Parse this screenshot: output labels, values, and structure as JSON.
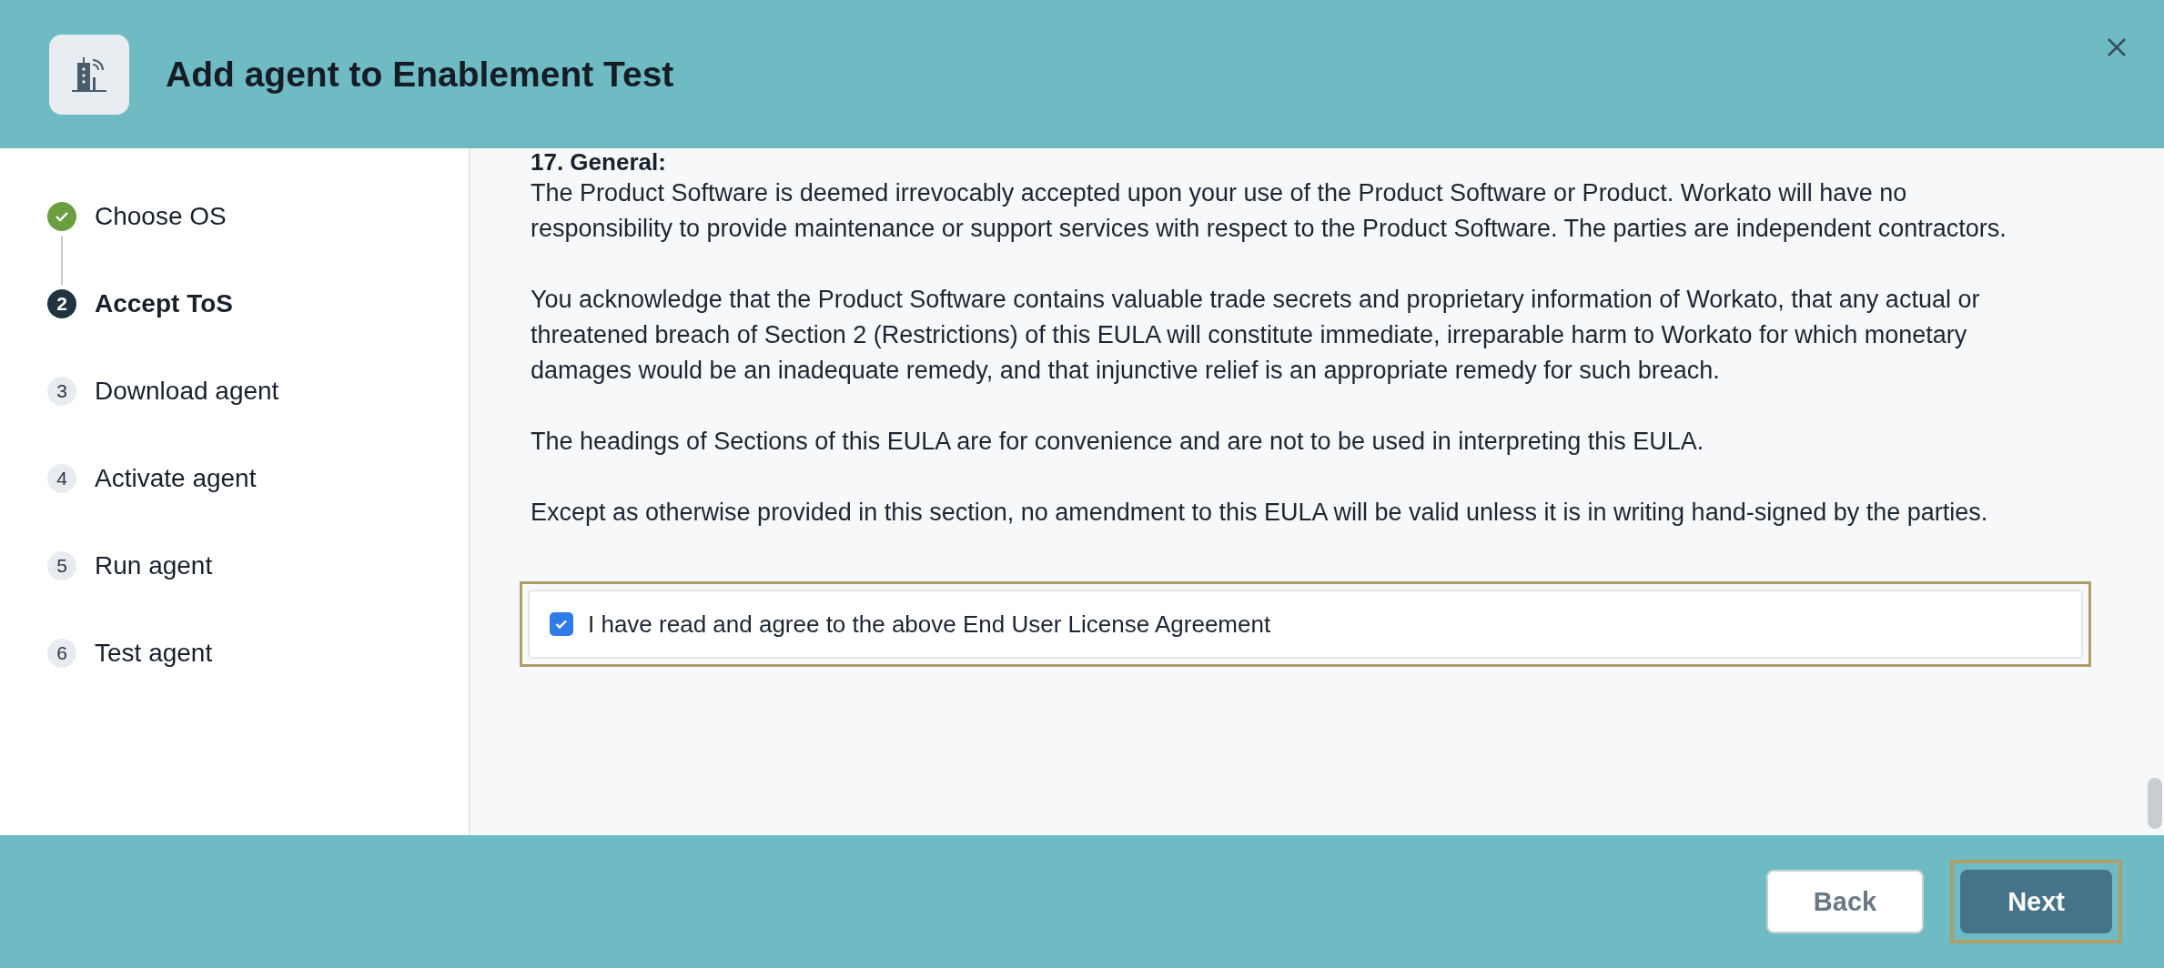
{
  "dialog": {
    "title": "Add agent to Enablement Test"
  },
  "steps": [
    {
      "kind": "done",
      "label": "Choose OS",
      "selected": false
    },
    {
      "kind": "number",
      "number": "2",
      "label": "Accept ToS",
      "selected": true
    },
    {
      "kind": "number",
      "number": "3",
      "label": "Download agent",
      "selected": false
    },
    {
      "kind": "number",
      "number": "4",
      "label": "Activate agent",
      "selected": false
    },
    {
      "kind": "number",
      "number": "5",
      "label": "Run agent",
      "selected": false
    },
    {
      "kind": "number",
      "number": "6",
      "label": "Test agent",
      "selected": false
    }
  ],
  "eula": {
    "heading": "17. General:",
    "paragraphs": [
      "The Product Software is deemed irrevocably accepted upon your use of the Product Software or Product. Workato will have no responsibility to provide maintenance or support services with respect to the Product Software. The parties are independent contractors.",
      "You acknowledge that the Product Software contains valuable trade secrets and proprietary information of Workato, that any actual or threatened breach of Section 2 (Restrictions) of this EULA will constitute immediate, irreparable harm to Workato for which monetary damages would be an inadequate remedy, and that injunctive relief is an appropriate remedy for such breach.",
      "The headings of Sections of this EULA are for convenience and are not to be used in interpreting this EULA.",
      "Except as otherwise provided in this section, no amendment to this EULA will be valid unless it is in writing hand-signed by the parties."
    ]
  },
  "agreement": {
    "label": "I have read and agree to the above End User License Agreement",
    "checked": true,
    "highlighted": true
  },
  "buttons": [
    {
      "kind": "secondary",
      "label": "Back",
      "highlighted": false
    },
    {
      "kind": "primary",
      "label": "Next",
      "highlighted": true
    }
  ]
}
